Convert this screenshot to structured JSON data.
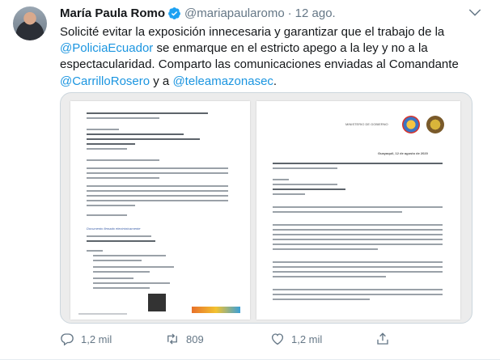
{
  "tweet": {
    "author_name": "María Paula Romo",
    "handle": "@mariapaularomo",
    "separator": "·",
    "date": "12 ago.",
    "text_parts": {
      "p1": "Solicité evitar la exposición innecesaria y garantizar que el trabajo de la ",
      "mention1": "@PoliciaEcuador",
      "p2": " se enmarque en el estricto apego a la ley y no a la espectacularidad. Comparto las comunicaciones enviadas al Comandante ",
      "mention2": "@CarrilloRosero",
      "p3": " y a ",
      "mention3": "@teleamazonasec",
      "p4": "."
    },
    "media": {
      "left_doc_label": "Documento firmado electrónicamente",
      "right_doc_header": "MINISTERIO DE GOBIERNO",
      "right_doc_date": "Guayaquil, 12 de agosto de 2020"
    },
    "actions": {
      "reply_count": "1,2 mil",
      "retweet_count": "809",
      "like_count": "1,2 mil"
    }
  },
  "colors": {
    "link": "#1b95e0",
    "secondary_text": "#657786",
    "verified": "#1da1f2"
  },
  "icons": [
    "verified-badge-icon",
    "chevron-down-icon",
    "reply-icon",
    "retweet-icon",
    "like-icon",
    "share-icon"
  ]
}
